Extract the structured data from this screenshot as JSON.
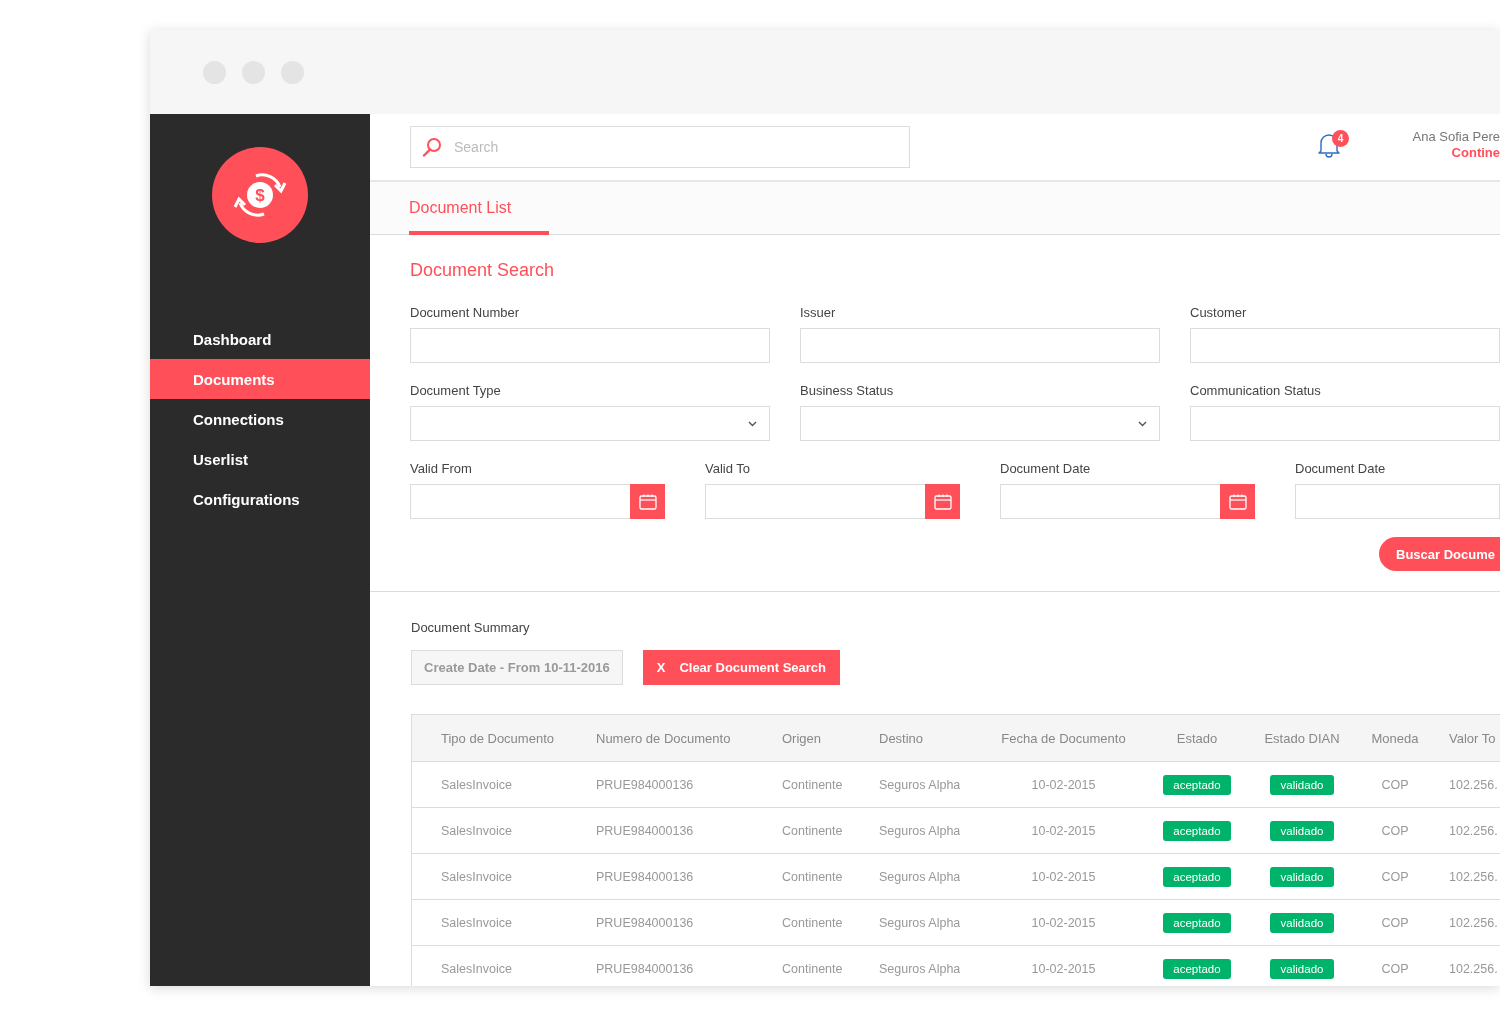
{
  "logo": {
    "symbol": "$"
  },
  "sidebar": {
    "items": [
      {
        "label": "Dashboard",
        "selected": false
      },
      {
        "label": "Documents",
        "selected": true
      },
      {
        "label": "Connections",
        "selected": false
      },
      {
        "label": "Userlist",
        "selected": false
      },
      {
        "label": "Configurations",
        "selected": false
      }
    ]
  },
  "topbar": {
    "search": {
      "placeholder": "Search"
    },
    "notifications": "4",
    "user": {
      "name": "Ana Sofia Pere",
      "company": "Contine"
    }
  },
  "tabs": [
    {
      "label": "Document List",
      "selected": true
    }
  ],
  "search_form": {
    "title": "Document Search",
    "rows": [
      [
        {
          "label": "Document Number",
          "kind": "text"
        },
        {
          "label": "Issuer",
          "kind": "text"
        },
        {
          "label": "Customer",
          "kind": "text"
        }
      ],
      [
        {
          "label": "Document Type",
          "kind": "select"
        },
        {
          "label": "Business Status",
          "kind": "select"
        },
        {
          "label": "Communication Status",
          "kind": "text"
        }
      ],
      [
        {
          "label": "Valid From",
          "kind": "date"
        },
        {
          "label": "Valid To",
          "kind": "date"
        },
        {
          "label": "Document Date",
          "kind": "date"
        },
        {
          "label": "Document Date",
          "kind": "text"
        }
      ]
    ],
    "submit": "Buscar Docume"
  },
  "summary": {
    "label": "Document Summary",
    "filter": "Create Date - From 10-11-2016",
    "clear_icon": "X",
    "clear_button": "Clear Document Search"
  },
  "table": {
    "columns": [
      "Tipo de Documento",
      "Numero de Documento",
      "Origen",
      "Destino",
      "Fecha de Documento",
      "Estado",
      "Estado DIAN",
      "Moneda",
      "Valor To"
    ],
    "rows": [
      [
        "SalesInvoice",
        "PRUE984000136",
        "Continente",
        "Seguros Alpha",
        "10-02-2015",
        "aceptado",
        "validado",
        "COP",
        "102.256."
      ],
      [
        "SalesInvoice",
        "PRUE984000136",
        "Continente",
        "Seguros Alpha",
        "10-02-2015",
        "aceptado",
        "validado",
        "COP",
        "102.256."
      ],
      [
        "SalesInvoice",
        "PRUE984000136",
        "Continente",
        "Seguros Alpha",
        "10-02-2015",
        "aceptado",
        "validado",
        "COP",
        "102.256."
      ],
      [
        "SalesInvoice",
        "PRUE984000136",
        "Continente",
        "Seguros Alpha",
        "10-02-2015",
        "aceptado",
        "validado",
        "COP",
        "102.256."
      ],
      [
        "SalesInvoice",
        "PRUE984000136",
        "Continente",
        "Seguros Alpha",
        "10-02-2015",
        "aceptado",
        "validado",
        "COP",
        "102.256."
      ]
    ]
  }
}
